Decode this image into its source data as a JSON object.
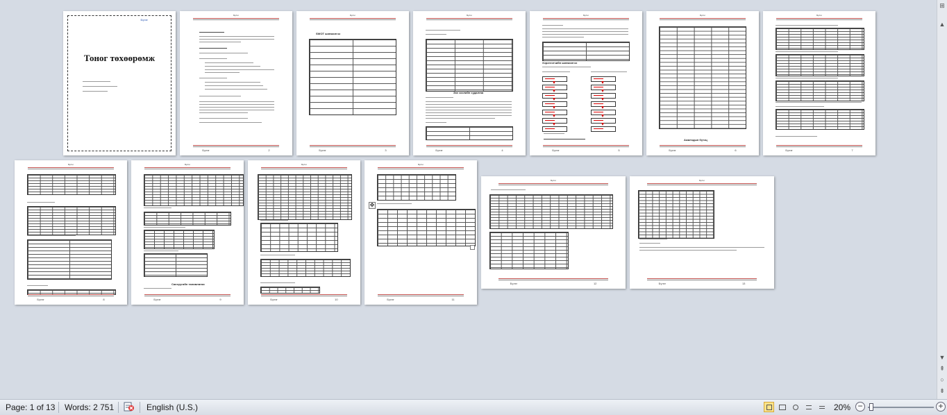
{
  "document": {
    "cover_title": "Тоног төхөөрөмж",
    "cover_header_text": "Бүлэг"
  },
  "pages": {
    "header_text": "Бүлэг",
    "footer_text": "Бүлэг",
    "section_titles": {
      "p3": "SWOT шинжилгээ",
      "p4": "Зах зээлийн судалгаа",
      "p5a": "Хэрэглэгчийн шинжилгээ",
      "p6": "Ажилчдын бүтэц",
      "p9": "Санхүүгийн төлөвлөгөө"
    },
    "page_numbers": [
      "2",
      "3",
      "4",
      "5",
      "6",
      "7",
      "8",
      "9",
      "10",
      "11",
      "12",
      "13"
    ]
  },
  "status_bar": {
    "page_info": "Page: 1 of 13",
    "words": "Words: 2 751",
    "language": "English (U.S.)",
    "zoom_percent": "20%",
    "zoom_out": "−",
    "zoom_in": "+"
  },
  "zoom": {
    "level_percent": 20
  },
  "icons": {
    "proofing": "proofing-icon",
    "view_print_layout": "print-layout-icon",
    "view_full_screen": "full-screen-reading-icon",
    "view_web": "web-layout-icon",
    "view_outline": "outline-icon",
    "view_draft": "draft-icon"
  },
  "colors": {
    "workspace": "#d5dbe4",
    "header_rule": "#c0504d",
    "active_view": "#fbe38a"
  }
}
